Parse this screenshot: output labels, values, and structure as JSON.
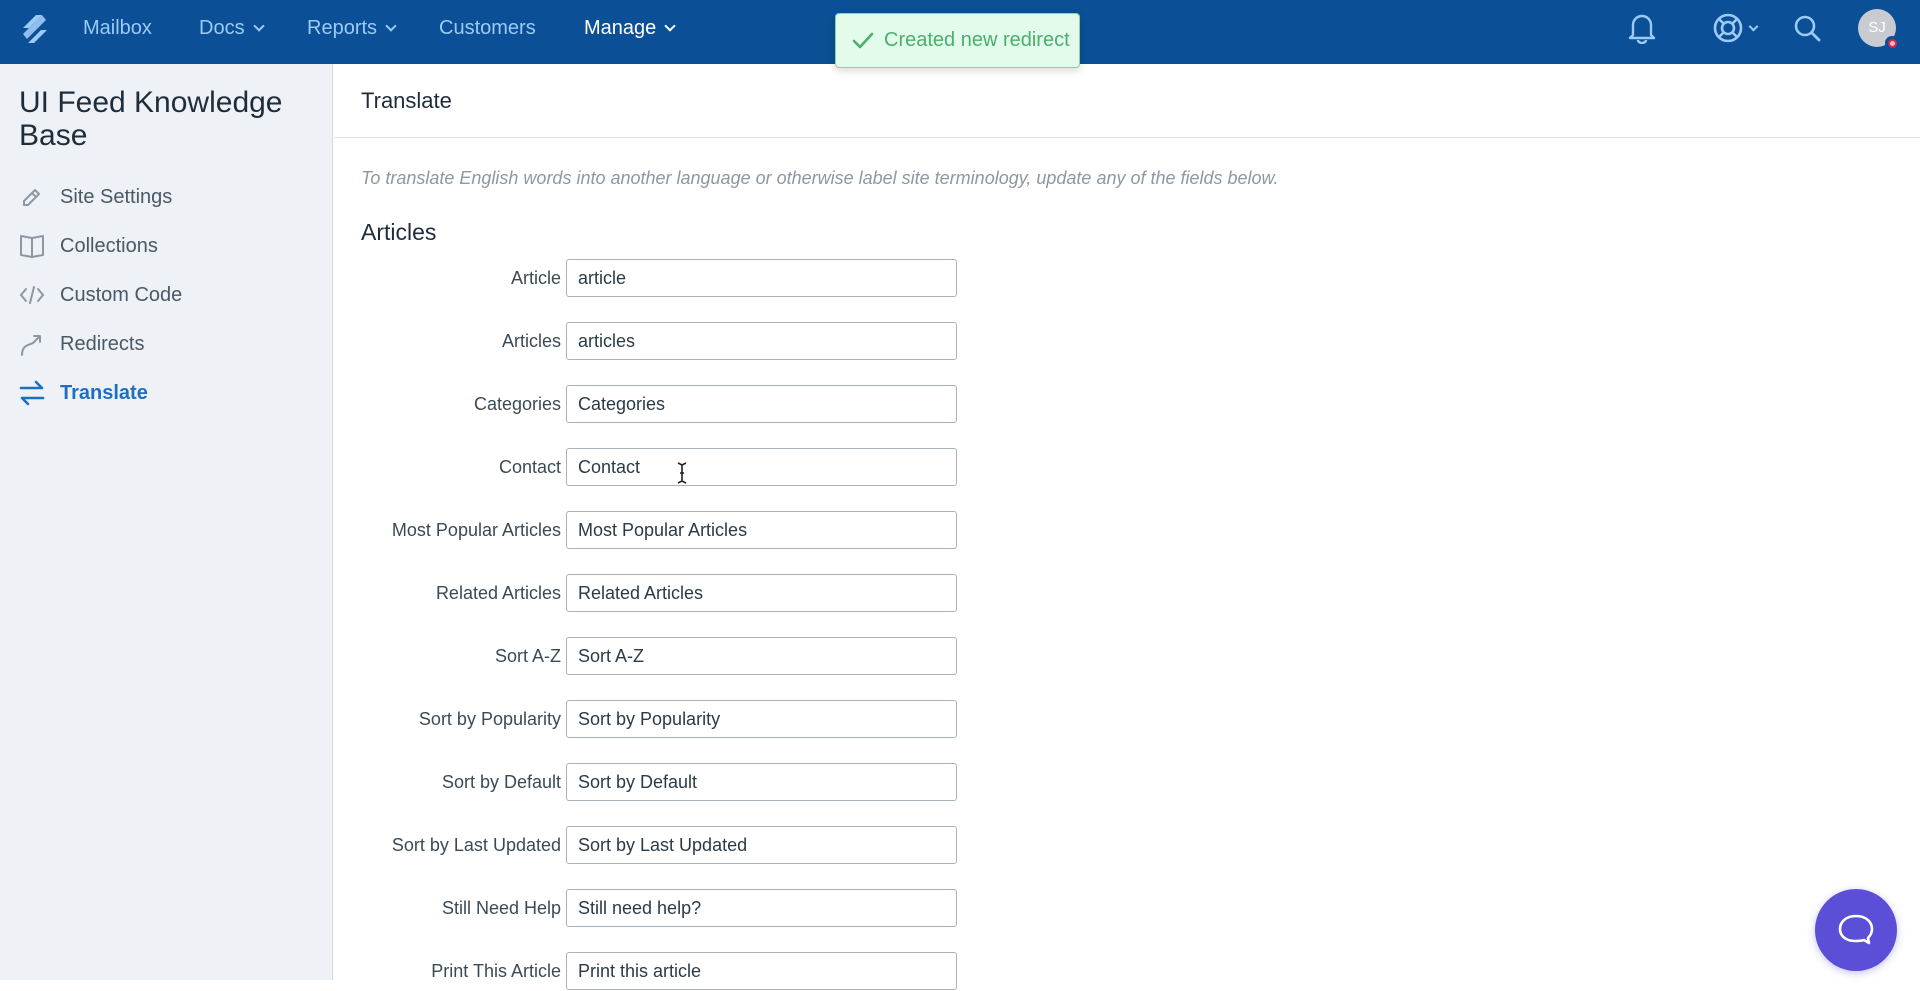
{
  "topbar": {
    "logo": "helpscout-logo",
    "nav": [
      {
        "label": "Mailbox",
        "dropdown": false,
        "active": false
      },
      {
        "label": "Docs",
        "dropdown": true,
        "active": false
      },
      {
        "label": "Reports",
        "dropdown": true,
        "active": false
      },
      {
        "label": "Customers",
        "dropdown": false,
        "active": false
      },
      {
        "label": "Manage",
        "dropdown": true,
        "active": true
      }
    ],
    "icons": [
      "bell-icon",
      "lifebuoy-icon",
      "search-icon"
    ],
    "avatar_initials": "SJ",
    "colors": {
      "bar": "#0b4f96",
      "link": "#9ccaf6"
    }
  },
  "toast": {
    "message": "Created new redirect",
    "icon": "check-icon"
  },
  "sidebar": {
    "title": "UI Feed Knowledge Base",
    "items": [
      {
        "label": "Site Settings",
        "icon": "pencil-icon",
        "active": false
      },
      {
        "label": "Collections",
        "icon": "book-icon",
        "active": false
      },
      {
        "label": "Custom Code",
        "icon": "code-icon",
        "active": false
      },
      {
        "label": "Redirects",
        "icon": "redirect-arrow-icon",
        "active": false
      },
      {
        "label": "Translate",
        "icon": "swap-arrows-icon",
        "active": true
      }
    ]
  },
  "main": {
    "title": "Translate",
    "help_text": "To translate English words into another language or otherwise label site terminology, update any of the fields below.",
    "section_title": "Articles",
    "fields": [
      {
        "label": "Article",
        "value": "article"
      },
      {
        "label": "Articles",
        "value": "articles"
      },
      {
        "label": "Categories",
        "value": "Categories"
      },
      {
        "label": "Contact",
        "value": "Contact"
      },
      {
        "label": "Most Popular Articles",
        "value": "Most Popular Articles"
      },
      {
        "label": "Related Articles",
        "value": "Related Articles"
      },
      {
        "label": "Sort A-Z",
        "value": "Sort A-Z"
      },
      {
        "label": "Sort by Popularity",
        "value": "Sort by Popularity"
      },
      {
        "label": "Sort by Default",
        "value": "Sort by Default"
      },
      {
        "label": "Sort by Last Updated",
        "value": "Sort by Last Updated"
      },
      {
        "label": "Still Need Help",
        "value": "Still need help?"
      },
      {
        "label": "Print This Article",
        "value": "Print this article"
      }
    ]
  },
  "beacon": {
    "icon": "chat-bubble-icon",
    "color": "#5a4fd6"
  }
}
